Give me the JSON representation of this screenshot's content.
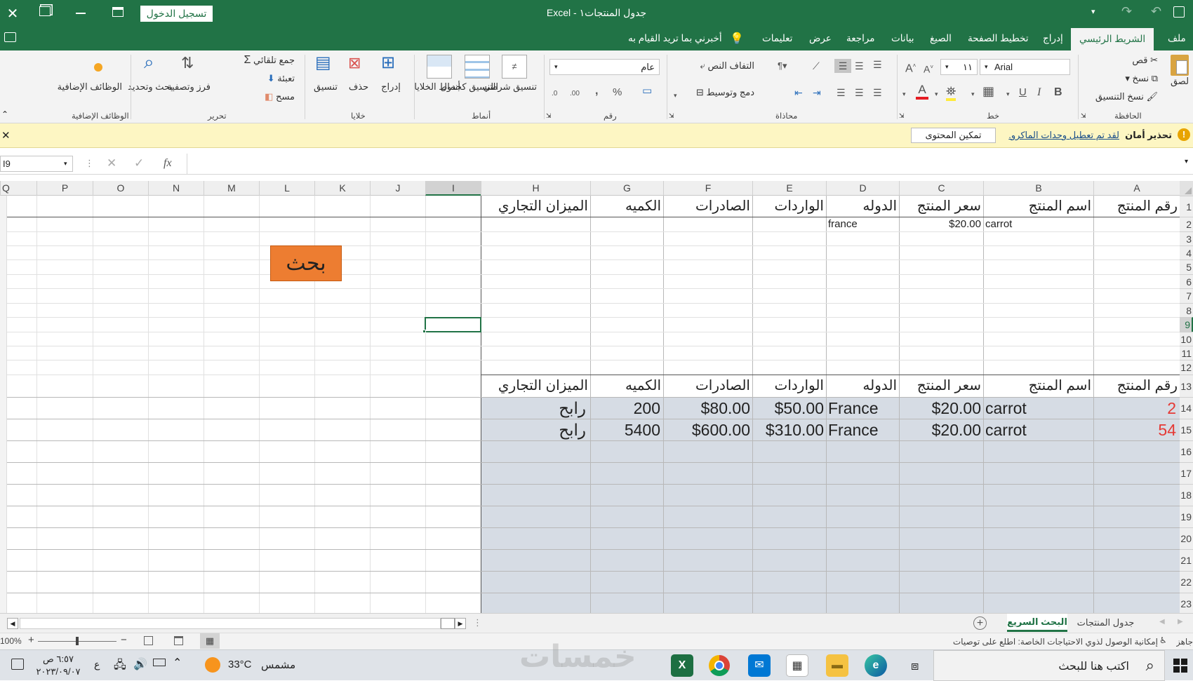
{
  "window": {
    "title": "جدول المنتجات١  -  Excel",
    "signin_label": "تسجيل الدخول"
  },
  "tabs": [
    "ملف",
    "الشريط الرئيسي",
    "إدراج",
    "تخطيط الصفحة",
    "الصيغ",
    "بيانات",
    "مراجعة",
    "عرض",
    "تعليمات"
  ],
  "tellme": "أخبرني بما تريد القيام به",
  "ribbon": {
    "groups": [
      "الحافظة",
      "خط",
      "محاذاة",
      "رقم",
      "أنماط",
      "خلايا",
      "تحرير",
      "الوظائف الإضافية"
    ],
    "paste": "لصق",
    "cut": "قص",
    "copy": "نسخ",
    "format_painter": "نسخ التنسيق",
    "font_name": "Arial",
    "font_size": "١١",
    "wrap_text": "التفاف النص",
    "merge_center": "دمج وتوسيط",
    "number_format": "عام",
    "cond_format": "تنسيق شرطي",
    "format_table": "التنسيق كجدول",
    "cell_styles": "أنماط الخلايا",
    "insert": "إدراج",
    "delete": "حذف",
    "format": "تنسيق",
    "autosum": "جمع تلقائي",
    "fill": "تعبئة",
    "clear": "مسح",
    "sort_filter": "فرز وتصفية",
    "find_select": "بحث وتحديد",
    "addins": "الوظائف الإضافية"
  },
  "security": {
    "title": "تحذير أمان",
    "message": "لقد تم تعطيل وحدات الماكرو.",
    "enable_button": "تمكين المحتوى"
  },
  "formula": {
    "name_box": "I9",
    "fx": "fx",
    "content": ""
  },
  "columns": [
    "A",
    "B",
    "C",
    "D",
    "E",
    "F",
    "G",
    "H",
    "I",
    "J",
    "K",
    "L",
    "M",
    "N",
    "O",
    "P",
    "Q"
  ],
  "rows": [
    "1",
    "2",
    "3",
    "4",
    "5",
    "6",
    "7",
    "8",
    "9",
    "10",
    "11",
    "12",
    "13",
    "14",
    "15",
    "16",
    "17",
    "18",
    "19",
    "20",
    "21",
    "22",
    "23"
  ],
  "table1": {
    "headers": [
      "رقم المنتج",
      "اسم المنتج",
      "سعر المنتج",
      "الدوله",
      "الواردات",
      "الصادرات",
      "الكميه",
      "الميزان التجاري"
    ],
    "row2": {
      "name": "carrot",
      "price": "$20.00",
      "country": "france"
    }
  },
  "search_button": "بحث",
  "table2": {
    "headers": [
      "رقم المنتج",
      "اسم المنتج",
      "سعر المنتج",
      "الدوله",
      "الواردات",
      "الصادرات",
      "الكميه",
      "الميزان التجاري"
    ],
    "rows": [
      [
        "2",
        "carrot",
        "$20.00",
        "France",
        "$50.00",
        "$80.00",
        "200",
        "رابح"
      ],
      [
        "54",
        "carrot",
        "$20.00",
        "France",
        "$310.00",
        "$600.00",
        "5400",
        "رابح"
      ]
    ]
  },
  "sheets": [
    "جدول المنتجات",
    "البحث السريع"
  ],
  "status": {
    "ready": "جاهز",
    "accessibility": "إمكانية الوصول لذوي الاحتياجات الخاصة: اطلع على توصيات",
    "zoom": "100%"
  },
  "taskbar": {
    "search": "اكتب هنا للبحث",
    "weather_temp": "33°C",
    "weather_desc": "مشمس",
    "lang": "ع",
    "time": "٦:٥٧ ص",
    "date": "٢٠٢٣/٠٩/٠٧",
    "watermark": "خمسات"
  }
}
